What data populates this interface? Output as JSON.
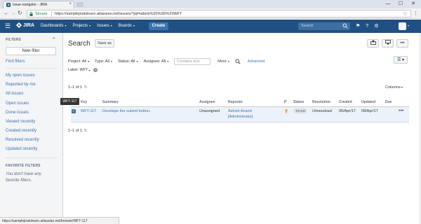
{
  "browser": {
    "tab_title": "Issue navigator - JIRA",
    "close_glyph": "×",
    "secure_label": "Secure",
    "url": "https://samplejiratolearn.atlassian.net/issues/?jql=labels%20%3D%20WFT",
    "minimize": "—",
    "maximize": "☐",
    "close": "✕",
    "status_url": "https://samplejiratolearn.atlassian.net/browse/WFT-117"
  },
  "header": {
    "logo": "JIRA",
    "nav": [
      "Dashboards",
      "Projects",
      "Issues",
      "Boards"
    ],
    "create_label": "Create",
    "search_placeholder": "Search",
    "brand_color": "#205081"
  },
  "sidebar": {
    "filters_heading": "FILTERS",
    "new_filter": "New filter",
    "find_filters": "Find filters",
    "links": [
      "My open issues",
      "Reported by me",
      "All issues",
      "Open issues",
      "Done issues",
      "Viewed recently",
      "Created recently",
      "Resolved recently",
      "Updated recently"
    ],
    "favorite_heading": "FAVORITE FILTERS",
    "favorite_empty": "You don't have any favorite filters."
  },
  "main": {
    "title": "Search",
    "save_as": "Save as",
    "filters": {
      "project": "Project: All",
      "type": "Type: All",
      "status": "Status: All",
      "assignee": "Assignee: All",
      "contains_placeholder": "Contains text",
      "more": "More",
      "advanced": "Advanced"
    },
    "label_filter": "Label: WFT",
    "count_top": "1–1 of 1",
    "count_bottom": "1–1 of 1",
    "columns_label": "Columns",
    "tooltip": "WFT-117"
  },
  "table": {
    "headers": [
      "Key",
      "Summary",
      "Assignee",
      "Reporter",
      "P",
      "Status",
      "Resolution",
      "Created",
      "Updated",
      "Due"
    ],
    "rows": [
      {
        "key": "WFT-117",
        "summary": "Develope the submit button.",
        "assignee": "Unassigned",
        "reporter_name": "Ashish Anand",
        "reporter_role": "[Administrator]",
        "status": "TO DO",
        "resolution": "Unresolved",
        "created": "05/Apr/17",
        "updated": "09/Apr/17",
        "due": ""
      }
    ]
  }
}
